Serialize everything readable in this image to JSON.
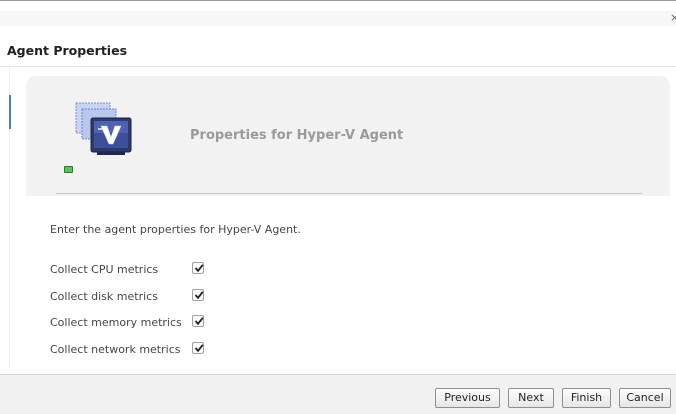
{
  "window": {
    "close_glyph": "×",
    "title": "Agent Properties"
  },
  "panel": {
    "heading": "Properties for Hyper-V Agent",
    "icon": "hyper-v-agent-icon",
    "status_color": "#58c258"
  },
  "form": {
    "instructions": "Enter the agent properties for Hyper-V Agent.",
    "metrics": [
      {
        "label": "Collect CPU metrics",
        "checked": true
      },
      {
        "label": "Collect disk metrics",
        "checked": true
      },
      {
        "label": "Collect memory metrics",
        "checked": true
      },
      {
        "label": "Collect network metrics",
        "checked": true
      }
    ]
  },
  "buttons": {
    "previous": "Previous",
    "next": "Next",
    "finish": "Finish",
    "cancel": "Cancel"
  }
}
